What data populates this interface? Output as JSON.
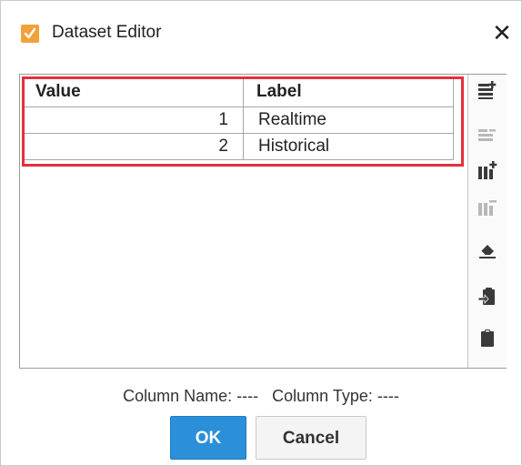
{
  "window": {
    "title": "Dataset Editor",
    "close_glyph": "✕",
    "icon": "checkmark-doc-icon",
    "icon_color": "#f2a23a"
  },
  "table": {
    "columns": [
      "Value",
      "Label"
    ],
    "rows": [
      {
        "value": "1",
        "label": "Realtime"
      },
      {
        "value": "2",
        "label": "Historical"
      }
    ],
    "highlight_color": "#e5303a"
  },
  "toolbar": {
    "icons": [
      "add-row-icon",
      "remove-row-icon",
      "add-column-icon",
      "remove-column-icon",
      "clear-eraser-icon",
      "paste-import-icon",
      "clipboard-icon"
    ]
  },
  "info": {
    "column_name_label": "Column Name:",
    "column_name_value": "----",
    "column_type_label": "Column Type:",
    "column_type_value": "----"
  },
  "buttons": {
    "ok": "OK",
    "cancel": "Cancel",
    "accent": "#2b90d9"
  }
}
